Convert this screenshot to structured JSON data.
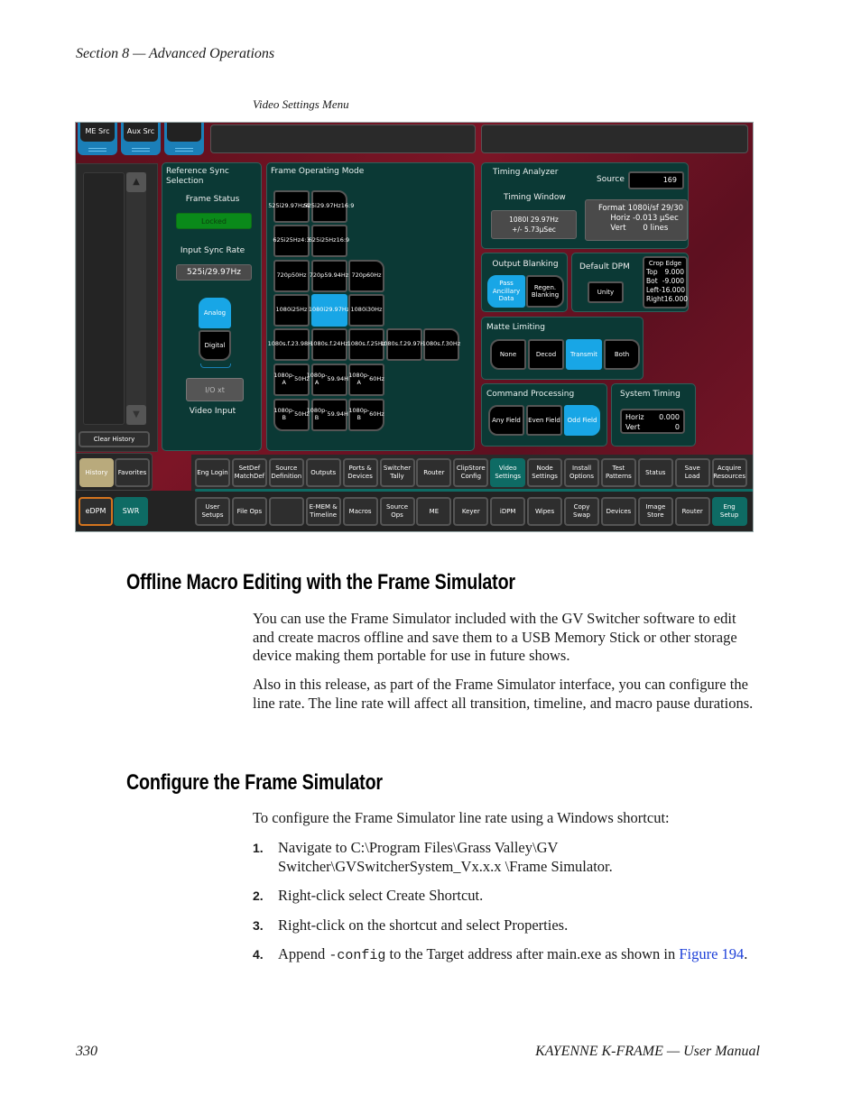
{
  "page": {
    "running_head": "Section 8 — Advanced Operations",
    "figure_caption": "Video Settings Menu",
    "footer_page": "330",
    "footer_title": "KAYENNE K-FRAME  —  User Manual"
  },
  "ui": {
    "top_buttons": [
      {
        "label": "ME Src"
      },
      {
        "label": "Aux Src"
      },
      {
        "label": ""
      }
    ],
    "history": {
      "clear_label": "Clear History",
      "history_tab": "History",
      "favorites_tab": "Favorites",
      "edpm_label": "eDPM",
      "swr_label": "SWR"
    },
    "ref_sync": {
      "title_line1": "Reference Sync",
      "title_line2": "Selection",
      "frame_status_label": "Frame Status",
      "frame_status_value": "Locked",
      "input_sync_label": "Input Sync Rate",
      "input_sync_value": "525i/29.97Hz",
      "analog_label": "Analog",
      "digital_label": "Digital",
      "ioxt_label": "I/O xt",
      "video_input_label": "Video Input",
      "selected_input": "Analog",
      "status_color": "#0a8a1a"
    },
    "frame_mode": {
      "title": "Frame Operating Mode",
      "selected": "1080i 29.97Hz",
      "rows": [
        [
          {
            "l1": "525i",
            "l2": "29.97Hz",
            "l3": "4:3"
          },
          {
            "l1": "525i",
            "l2": "29.97Hz",
            "l3": "16:9"
          }
        ],
        [
          {
            "l1": "625i",
            "l2": "25Hz",
            "l3": "4:3"
          },
          {
            "l1": "625i",
            "l2": "25Hz",
            "l3": "16:9"
          }
        ],
        [
          {
            "l1": "720p",
            "l2": "50Hz"
          },
          {
            "l1": "720p",
            "l2": "59.94Hz"
          },
          {
            "l1": "720p",
            "l2": "60Hz"
          }
        ],
        [
          {
            "l1": "1080i",
            "l2": "25Hz"
          },
          {
            "l1": "1080i",
            "l2": "29.97Hz"
          },
          {
            "l1": "1080i",
            "l2": "30Hz"
          }
        ],
        [
          {
            "l1": "1080s.f.",
            "l2": "23.98Hz"
          },
          {
            "l1": "1080s.f.",
            "l2": "24Hz"
          },
          {
            "l1": "1080s.f.",
            "l2": "25Hz"
          },
          {
            "l1": "1080s.f.",
            "l2": "29.97Hz"
          },
          {
            "l1": "1080s.f.",
            "l2": "30Hz"
          }
        ],
        [
          {
            "l1": "1080p-A",
            "l2": "50Hz"
          },
          {
            "l1": "1080p-A",
            "l2": "59.94Hz"
          },
          {
            "l1": "1080p-A",
            "l2": "60Hz"
          }
        ],
        [
          {
            "l1": "1080p-B",
            "l2": "50Hz"
          },
          {
            "l1": "1080p-B",
            "l2": "59.94Hz"
          },
          {
            "l1": "1080p-B",
            "l2": "60Hz"
          }
        ]
      ]
    },
    "timing": {
      "title": "Timing Analyzer",
      "source_label": "Source",
      "source_value": "169",
      "window_label": "Timing Window",
      "window_line1": "1080I 29.97Hz",
      "window_line2": "+/- 5.73µSec",
      "format_label": "Format",
      "format_value": "1080i/sf 29/30",
      "horiz_label": "Horiz",
      "horiz_value": "-0.013 µSec",
      "vert_label": "Vert",
      "vert_value": "0 lines"
    },
    "output_blanking": {
      "title": "Output Blanking",
      "pass_label": "Pass Ancillary Data",
      "regen_label": "Regen. Blanking",
      "selected": "Pass Ancillary Data"
    },
    "default_dpm": {
      "title": "Default DPM",
      "unity_label": "Unity",
      "crop_title": "Crop Edge",
      "crop": [
        {
          "k": "Top",
          "v": "9.000"
        },
        {
          "k": "Bot",
          "v": "-9.000"
        },
        {
          "k": "Left",
          "v": "-16.000"
        },
        {
          "k": "Right",
          "v": "16.000"
        }
      ]
    },
    "matte": {
      "title": "Matte Limiting",
      "options": [
        "None",
        "Decod",
        "Transmit",
        "Both"
      ],
      "selected": "Transmit"
    },
    "command": {
      "title": "Command Processing",
      "options": [
        "Any Field",
        "Even Field",
        "Odd Field"
      ],
      "selected": "Odd Field"
    },
    "system_timing": {
      "title": "System Timing",
      "horiz_label": "Horiz",
      "horiz_value": "0.000",
      "vert_label": "Vert",
      "vert_value": "0"
    },
    "nav_row1": [
      "Eng Login",
      "SetDef MatchDef",
      "Source Definition",
      "Outputs",
      "Ports & Devices",
      "Switcher Tally",
      "Router",
      "ClipStore Config",
      "Video Settings",
      "Node Settings",
      "Install Options",
      "Test Patterns",
      "Status",
      "Save Load",
      "Acquire Resources"
    ],
    "nav_row1_active": "Video Settings",
    "nav_row2": [
      "User Setups",
      "File Ops",
      "",
      "E-MEM & Timeline",
      "Macros",
      "Source Ops",
      "ME",
      "Keyer",
      "iDPM",
      "Wipes",
      "Copy Swap",
      "Devices",
      "Image Store",
      "Router",
      "Eng Setup"
    ],
    "nav_row2_active": "Eng Setup",
    "colors": {
      "accent_blue": "#18a6e6",
      "active_teal": "#0e6b64",
      "panel_bg": "#0b3935",
      "history_tan": "#b9aa7c",
      "edpm_orange": "#d4741e"
    }
  },
  "section1": {
    "heading": "Offline Macro Editing with the Frame Simulator",
    "para1": "You can use the Frame Simulator included with the GV Switcher software to edit and create macros offline and save them to a USB Memory Stick or other storage device making them portable for use in future shows.",
    "para2": "Also in this release, as part of the Frame Simulator interface, you can configure the line rate. The line rate will affect all transition, timeline, and macro pause durations."
  },
  "section2": {
    "heading": "Configure the Frame Simulator",
    "intro": "To configure the Frame Simulator line rate using a Windows shortcut:",
    "steps": [
      {
        "num": "1.",
        "text": "Navigate to C:\\Program Files\\Grass Valley\\GV Switcher\\GVSwitcherSystem_Vx.x.x \\Frame Simulator."
      },
      {
        "num": "2.",
        "text": "Right-click select Create Shortcut."
      },
      {
        "num": "3.",
        "text": "Right-click on the shortcut and select Properties."
      },
      {
        "num": "4.",
        "pre": "Append ",
        "code": "-config",
        "post": " to the Target address after main.exe as shown in ",
        "link": "Figure 194",
        "end": "."
      }
    ]
  }
}
